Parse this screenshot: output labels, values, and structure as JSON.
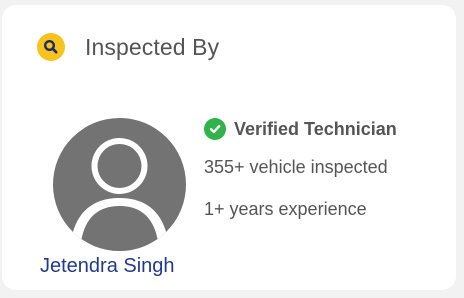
{
  "header": {
    "icon": "search-icon",
    "title": "Inspected By"
  },
  "technician": {
    "name": "Jetendra Singh",
    "avatar_icon": "user-avatar-icon",
    "verified_icon": "check-circle-icon",
    "verified_label": "Verified Technician",
    "vehicles_inspected": "355+ vehicle inspected",
    "experience": "1+ years experience"
  },
  "colors": {
    "accent_yellow": "#f7c31c",
    "verified_green": "#2fb34a",
    "name_blue": "#1f3a93",
    "avatar_gray": "#737373"
  }
}
